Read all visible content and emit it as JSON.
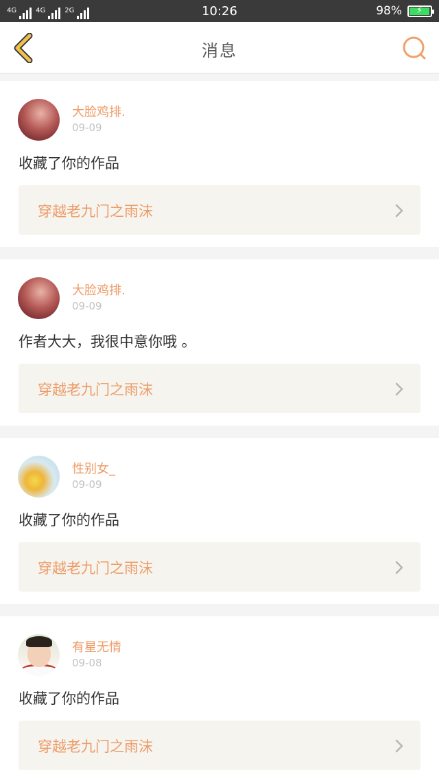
{
  "status_bar": {
    "network_1": "4G",
    "network_2": "4G",
    "network_3": "2G",
    "time": "10:26",
    "battery": "98%",
    "battery_level": 0.98
  },
  "header": {
    "title": "消息",
    "back_icon": "back-chevron-icon",
    "search_icon": "search-icon"
  },
  "messages": [
    {
      "username": "大脸鸡排.",
      "date": "09-09",
      "text": "收藏了你的作品",
      "work_title": "穿越老九门之雨沫"
    },
    {
      "username": "大脸鸡排.",
      "date": "09-09",
      "text": "作者大大，我很中意你哦 。",
      "work_title": "穿越老九门之雨沫"
    },
    {
      "username": "性别女_",
      "date": "09-09",
      "text": "收藏了你的作品",
      "work_title": "穿越老九门之雨沫"
    },
    {
      "username": "有星无情",
      "date": "09-08",
      "text": "收藏了你的作品",
      "work_title": "穿越老九门之雨沫"
    }
  ],
  "colors": {
    "accent": "#ee9b66",
    "back_icon": "#f0c14b",
    "search_icon": "#f2a06a",
    "card_link_bg": "#f5f4ef",
    "status_bar_bg": "#3a3a3a"
  }
}
